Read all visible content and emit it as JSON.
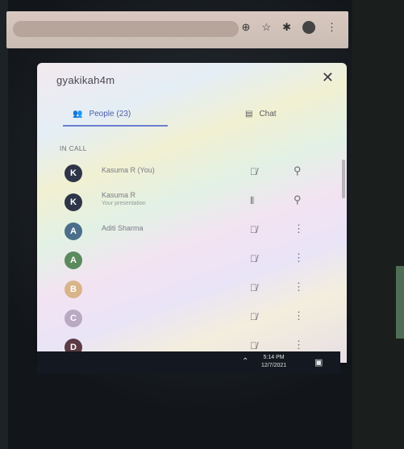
{
  "panel": {
    "title": "gyakikah4m",
    "close_icon": "close-icon"
  },
  "tabs": {
    "people_label": "People (23)",
    "people_icon": "people-icon",
    "chat_label": "Chat",
    "chat_icon": "chat-icon"
  },
  "section_label": "IN CALL",
  "participants": [
    {
      "initial": "K",
      "name": "Kasuma R (You)",
      "subtitle": "",
      "avatar_color": "#2f3548",
      "mic_icon": "mic-off-icon",
      "action_icon": "pin-icon"
    },
    {
      "initial": "K",
      "name": "Kasuma R",
      "subtitle": "Your presentation",
      "avatar_color": "#2f3548",
      "mic_icon": "speaking-icon",
      "action_icon": "pin-icon"
    },
    {
      "initial": "A",
      "name": "Aditi Sharma",
      "subtitle": "",
      "avatar_color": "#4b6f8a",
      "mic_icon": "mic-off-icon",
      "action_icon": "more-vert-icon"
    },
    {
      "initial": "A",
      "name": "",
      "subtitle": "",
      "avatar_color": "#5a8a5e",
      "mic_icon": "mic-off-icon",
      "action_icon": "more-vert-icon"
    },
    {
      "initial": "B",
      "name": "",
      "subtitle": "",
      "avatar_color": "#d8b48a",
      "mic_icon": "mic-off-icon",
      "action_icon": "more-vert-icon"
    },
    {
      "initial": "C",
      "name": "",
      "subtitle": "",
      "avatar_color": "#b9a9c2",
      "mic_icon": "mic-off-icon",
      "action_icon": "more-vert-icon"
    },
    {
      "initial": "D",
      "name": "",
      "subtitle": "",
      "avatar_color": "#5c3a44",
      "mic_icon": "mic-off-icon",
      "action_icon": "more-vert-icon"
    }
  ],
  "taskbar": {
    "time": "5:14 PM",
    "date": "12/7/2021"
  }
}
